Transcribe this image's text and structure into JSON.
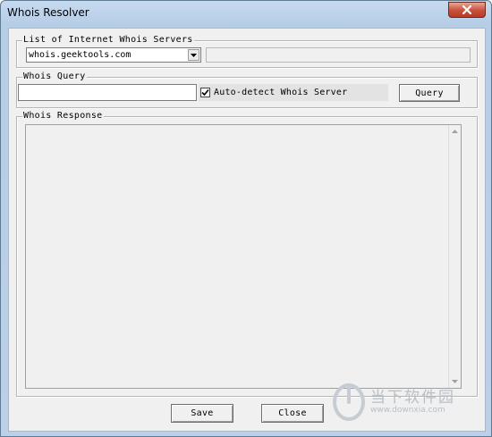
{
  "window": {
    "title": "Whois Resolver"
  },
  "servers_group": {
    "legend": "List of Internet Whois Servers",
    "selected_server": "whois.geektools.com",
    "info_text": ""
  },
  "query_group": {
    "legend": "Whois Query",
    "query_value": "",
    "autodetect_label": "Auto-detect Whois Server",
    "autodetect_checked": true,
    "query_button": "Query"
  },
  "response_group": {
    "legend": "Whois Response",
    "response_text": ""
  },
  "footer": {
    "save_button": "Save",
    "close_button": "Close"
  },
  "watermark": {
    "brand": "当下软件园",
    "url": "www.downxia.com"
  },
  "colors": {
    "title_gradient": "#bcd1e8",
    "dialog_bg": "#f0f0f0",
    "close_button": "#c7503a"
  }
}
